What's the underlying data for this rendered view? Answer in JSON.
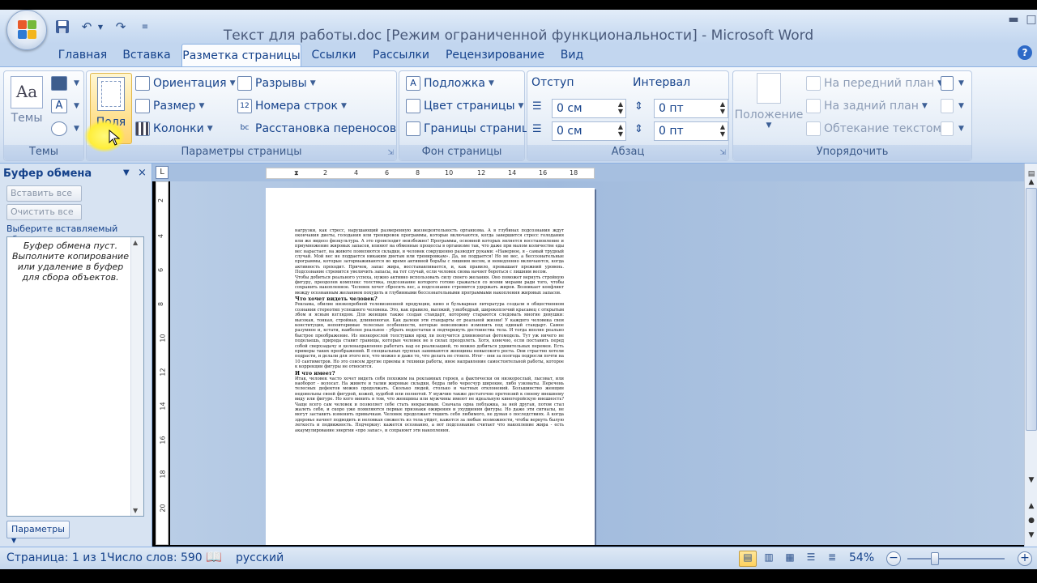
{
  "window": {
    "title": "Текст для работы.doc [Режим ограниченной функциональности] - Microsoft Word"
  },
  "tabs": [
    "Главная",
    "Вставка",
    "Разметка страницы",
    "Ссылки",
    "Рассылки",
    "Рецензирование",
    "Вид"
  ],
  "active_tab": "Разметка страницы",
  "ribbon": {
    "themes": {
      "label": "Темы",
      "button": "Темы"
    },
    "page_setup": {
      "label": "Параметры страницы",
      "margins": "Поля",
      "orientation": "Ориентация",
      "size": "Размер",
      "columns": "Колонки",
      "breaks": "Разрывы",
      "line_numbers": "Номера строк",
      "hyphenation": "Расстановка переносов"
    },
    "page_background": {
      "label": "Фон страницы",
      "watermark": "Подложка",
      "page_color": "Цвет страницы",
      "page_borders": "Границы страниц"
    },
    "paragraph": {
      "label": "Абзац",
      "indent": "Отступ",
      "spacing": "Интервал",
      "indent_left": "0 см",
      "indent_right": "0 см",
      "spacing_before": "0 пт",
      "spacing_after": "0 пт"
    },
    "arrange": {
      "label": "Упорядочить",
      "position": "Положение",
      "bring_front": "На передний план",
      "send_back": "На задний план",
      "text_wrap": "Обтекание текстом"
    }
  },
  "clipboard": {
    "title": "Буфер обмена",
    "paste_all": "Вставить все",
    "clear_all": "Очистить все",
    "select_label": "Выберите вставляемый объект:",
    "empty_msg": "Буфер обмена пуст. Выполните копирование или удаление в буфер для сбора объектов.",
    "options": "Параметры"
  },
  "ruler": {
    "ticks": [
      "2",
      "4",
      "6",
      "8",
      "10",
      "12",
      "14",
      "16",
      "18"
    ],
    "vticks": [
      "2",
      "4",
      "6",
      "8",
      "10",
      "12",
      "14",
      "16",
      "18",
      "20"
    ]
  },
  "document": {
    "p1": "нагрузки, как стресс, нарушающий размеренную жизнедеятельность организма. А в глубинах подсознания ждут окончания диеты, голодания или тренировок программы, которые включаются, когда завершится стресс голодания или же видеоз физкультура. А это происходит неизбежно! Программы, основной которых является восстановление и приумножение жировых запасов, влияют на обменные процессы в организме так, что даже при малом количестве еды вес нарастает, на животе появляются складки, и человек сокрушенно разводит руками: «Наверное, я - самый трудный случай. Мой вес не поддается никаким диетам или тренировкам». Да, не поддается! Но не вес, а бессознательные программы, которые затормаживаются во время активной борьбы с лишним весом, и немедленно включаются, когда активность проходит. Причем, запас жира, восстанавливается, и, как правило, превышает прежний уровень. Подсознание стремится увеличить запасы, на тот случай, если человек снова начнет бороться с лишним весом.",
    "p2": "Чтобы добиться реального успеха, нужно активно использовать силу своего желания. Оно поможет вернуть стройную фигуру, преодолев комплекс толстяка, подсознание которого готово сражаться со всеми мерами ради того, чтобы сохранить накопленное. Человек хочет сбросить вес, а подсознание стремится удержать жиров. Возникает конфликт между осознанным желанием похудеть и глубинными бессознательными программами накопления жировых запасов.",
    "h1": "Что хочет видеть человек?",
    "p3": "Реклама, обилие низкопробной телевизионной продукции, кино и бульварная литература создали в общественном сознании стереотип успешного человека. Это, как правило, высокий, узкобедрый, широкоплечий красавец с открытым лбом и ясным взглядом. Для женщин также создан стандарт, которому стараются следовать многие девушки: высокая, тонкая, стройная, длинноногая. Как далеки эти стандарты от реальной жизни! У каждого человека своя конституция, неповторимые телесные особенности, которые невозможно изменить под единый стандарт. Самое разумное и, кстати, наиболее реальное - убрать недостатки и подчеркнуть достоинства тела. И тогда вполне реально быстрое преображение. Из низкорослой толстушки вряд ли получится длинноногая фотомодель. Тут уж ничего не поделаешь, природа ставит границы, которые человек не в силах преодолеть. Хотя, конечно, если поставить перед собой сверхзадачу и целенаправленно работать над ее реализацией, то можно добиться удивительных перемен. Есть примеры таких преображений. В специальных группах занимаются женщины невысокого роста. Они страстно хотели подрасти, и делали для этого все, что можно и даже то, что делать не стоило. Итог - они за полгода подросли почти на 10 сантиметров. Но это совсем другие приемы и техники работы, иное направление самостоятельной работы, которое к коррекции фигуры не относится.",
    "h2": "И что имеет?",
    "p4": "Итак, человек часто хочет видеть себя похожим на рекламных героев, а фактически он низкорослый, лысоват, или наоборот - волосат. На животе и талии жировые складки, бедра либо чересчур широкие, либо узковаты. Перечень телесных дефектов можно продолжать. Сколько людей, столько и частных отклонений. Большинство женщин недовольны своей фигурой, кожей, худобой или полнотой. У мужчин также достаточно претензий к своему внешнему виду или фигуре. Но кого винить в том, что женщины или мужчины имеют не идеальную киногеройскую внешность? Чаще всего сам человек и позволяет себе стать некрасивым. Сначала одна поблажка, за ней другая, потом стал жалеть себя, и скоро уже появляются первые признаки ожирения и ухудшения фигуры. Но даже эти сигналы, не могут заставить изменить привычкам. Человек продолжает тешить себя любимого, не думая о последствиях. А когда здоровье начнет подводить и неловкая свежесть из тела уйдет, кажется за любые возможности, чтобы вернуть былую легкость и подвижность. Подчеркну: кажется осознанно, а вот подсознание считает что накопление жира - есть акаумулирование энергии «про запас», и сохраняет эти накопления."
  },
  "status": {
    "page": "Страница: 1 из 1",
    "words": "Число слов: 590",
    "lang": "русский",
    "zoom": "54%"
  }
}
